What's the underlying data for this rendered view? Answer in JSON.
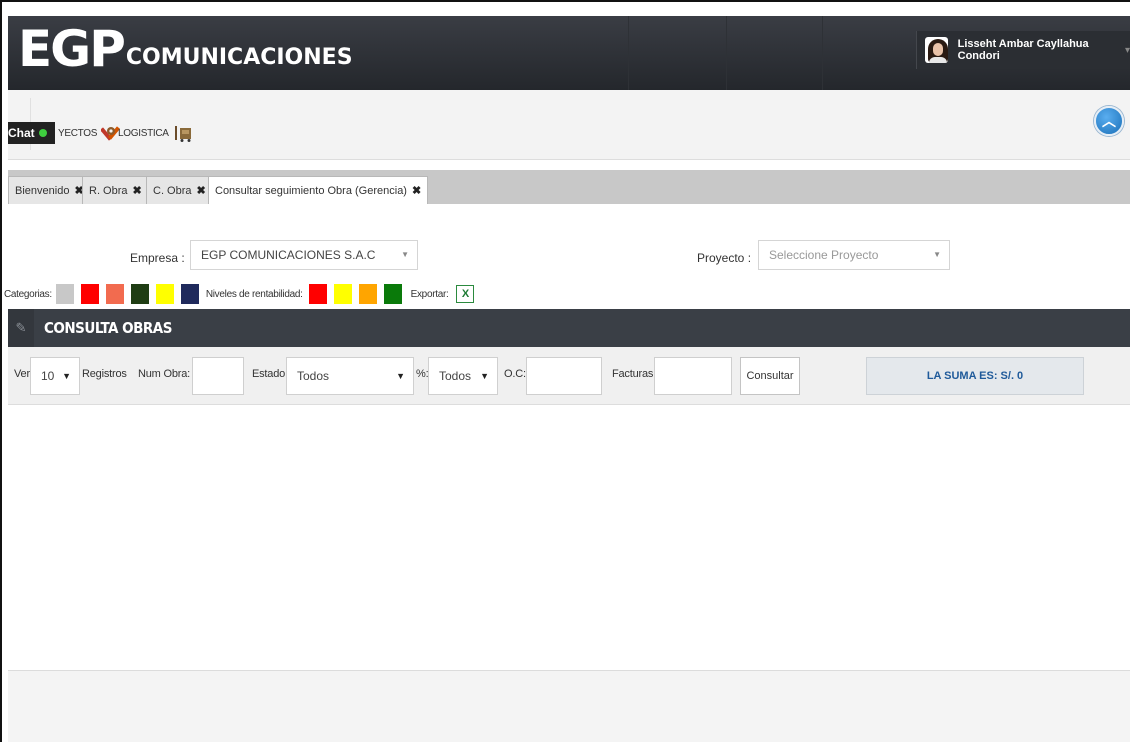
{
  "header": {
    "logo_main": "EGP",
    "logo_sub": "COMUNICACIONES",
    "user_name": "Lisseht Ambar Cayllahua Condori"
  },
  "menu": {
    "chat_label": "Chat",
    "items": [
      {
        "label": "YECTOS"
      },
      {
        "label": "LOGISTICA"
      }
    ]
  },
  "tabs": [
    {
      "label": "Bienvenido"
    },
    {
      "label": "R. Obra"
    },
    {
      "label": "C. Obra"
    },
    {
      "label": "Consultar seguimiento Obra (Gerencia)"
    }
  ],
  "filters": {
    "empresa_label": "Empresa :",
    "empresa_value": "EGP COMUNICACIONES S.A.C",
    "proyecto_label": "Proyecto :",
    "proyecto_placeholder": "Seleccione Proyecto"
  },
  "legend": {
    "categorias_label": "Categorias:",
    "categorias_colors": [
      "#c8c8c8",
      "#ff0000",
      "#f26b4f",
      "#1f3d14",
      "#ffff00",
      "#1f2a5c"
    ],
    "niveles_label": "Niveles de rentabilidad:",
    "niveles_colors": [
      "#ff0000",
      "#ffff00",
      "#ffa500",
      "#0a7a0a"
    ],
    "exportar_label": "Exportar:"
  },
  "panel": {
    "title": "CONSULTA OBRAS"
  },
  "toolbar": {
    "ver_label": "Ver",
    "ver_value": "10",
    "registros_label": "Registros",
    "num_obra_label": "Num Obra:",
    "estado_label": "Estado:",
    "estado_value": "Todos",
    "pct_label": "%:",
    "pct_value": "Todos",
    "oc_label": "O.C:",
    "facturas_label": "Facturas:",
    "consultar_label": "Consultar",
    "suma_text": "LA SUMA ES: S/. 0"
  }
}
